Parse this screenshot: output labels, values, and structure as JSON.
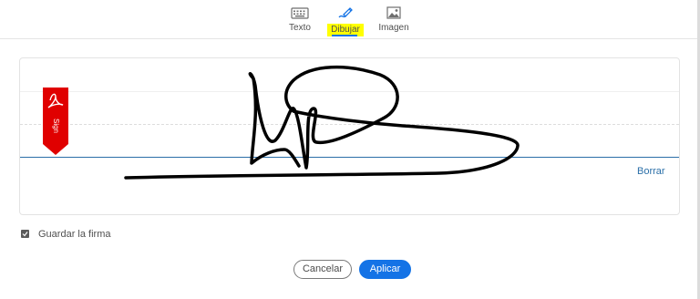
{
  "tabs": [
    {
      "label": "Texto",
      "icon": "keyboard-icon",
      "active": false
    },
    {
      "label": "Dibujar",
      "icon": "pen-draw-icon",
      "active": true
    },
    {
      "label": "Imagen",
      "icon": "image-icon",
      "active": false
    }
  ],
  "canvas": {
    "flag_text": "Sign",
    "clear_label": "Borrar"
  },
  "save_signature": {
    "label": "Guardar la firma",
    "checked": true
  },
  "buttons": {
    "cancel_label": "Cancelar",
    "apply_label": "Aplicar"
  },
  "colors": {
    "accent": "#1473e6",
    "highlight": "#ffff00",
    "flag": "#e00000",
    "baseline": "#2b6fa8"
  }
}
